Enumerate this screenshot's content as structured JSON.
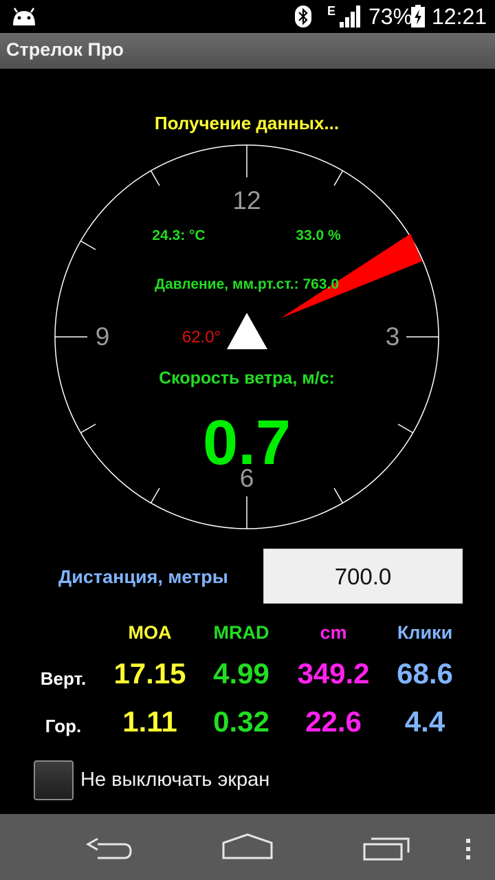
{
  "status_bar": {
    "network_type": "E",
    "battery": "73%",
    "time": "12:21",
    "icons": [
      "android-icon",
      "bluetooth-icon",
      "signal-icon",
      "battery-charging-icon"
    ]
  },
  "app": {
    "title": "Стрелок Про"
  },
  "gauge": {
    "status": "Получение данных...",
    "hours": {
      "top": "12",
      "right": "3",
      "bottom": "6",
      "left": "9"
    },
    "temperature": "24.3: °C",
    "humidity": "33.0 %",
    "pressure": "Давление, мм.рт.ст.: 763.0",
    "wind_angle_label": "62.0°",
    "wind_speed_label": "Скорость ветра, м/с:",
    "wind_speed": "0.7",
    "wind_direction_deg": 62,
    "colors": {
      "wind_pointer": "#ff0000",
      "readings": "#22dd22",
      "status": "#ffff33",
      "angle": "#dd1111"
    }
  },
  "distance": {
    "label": "Дистанция, метры",
    "value": "700.0"
  },
  "table": {
    "headers": [
      "MOA",
      "MRAD",
      "cm",
      "Клики"
    ],
    "rows": [
      {
        "label": "Верт.",
        "values": [
          "17.15",
          "4.99",
          "349.2",
          "68.6"
        ]
      },
      {
        "label": "Гор.",
        "values": [
          "1.11",
          "0.32",
          "22.6",
          "4.4"
        ]
      }
    ]
  },
  "keep_screen": {
    "label": "Не выключать экран",
    "checked": false
  },
  "nav": {
    "icons": [
      "back-icon",
      "home-icon",
      "recents-icon",
      "overflow-menu-icon"
    ]
  }
}
